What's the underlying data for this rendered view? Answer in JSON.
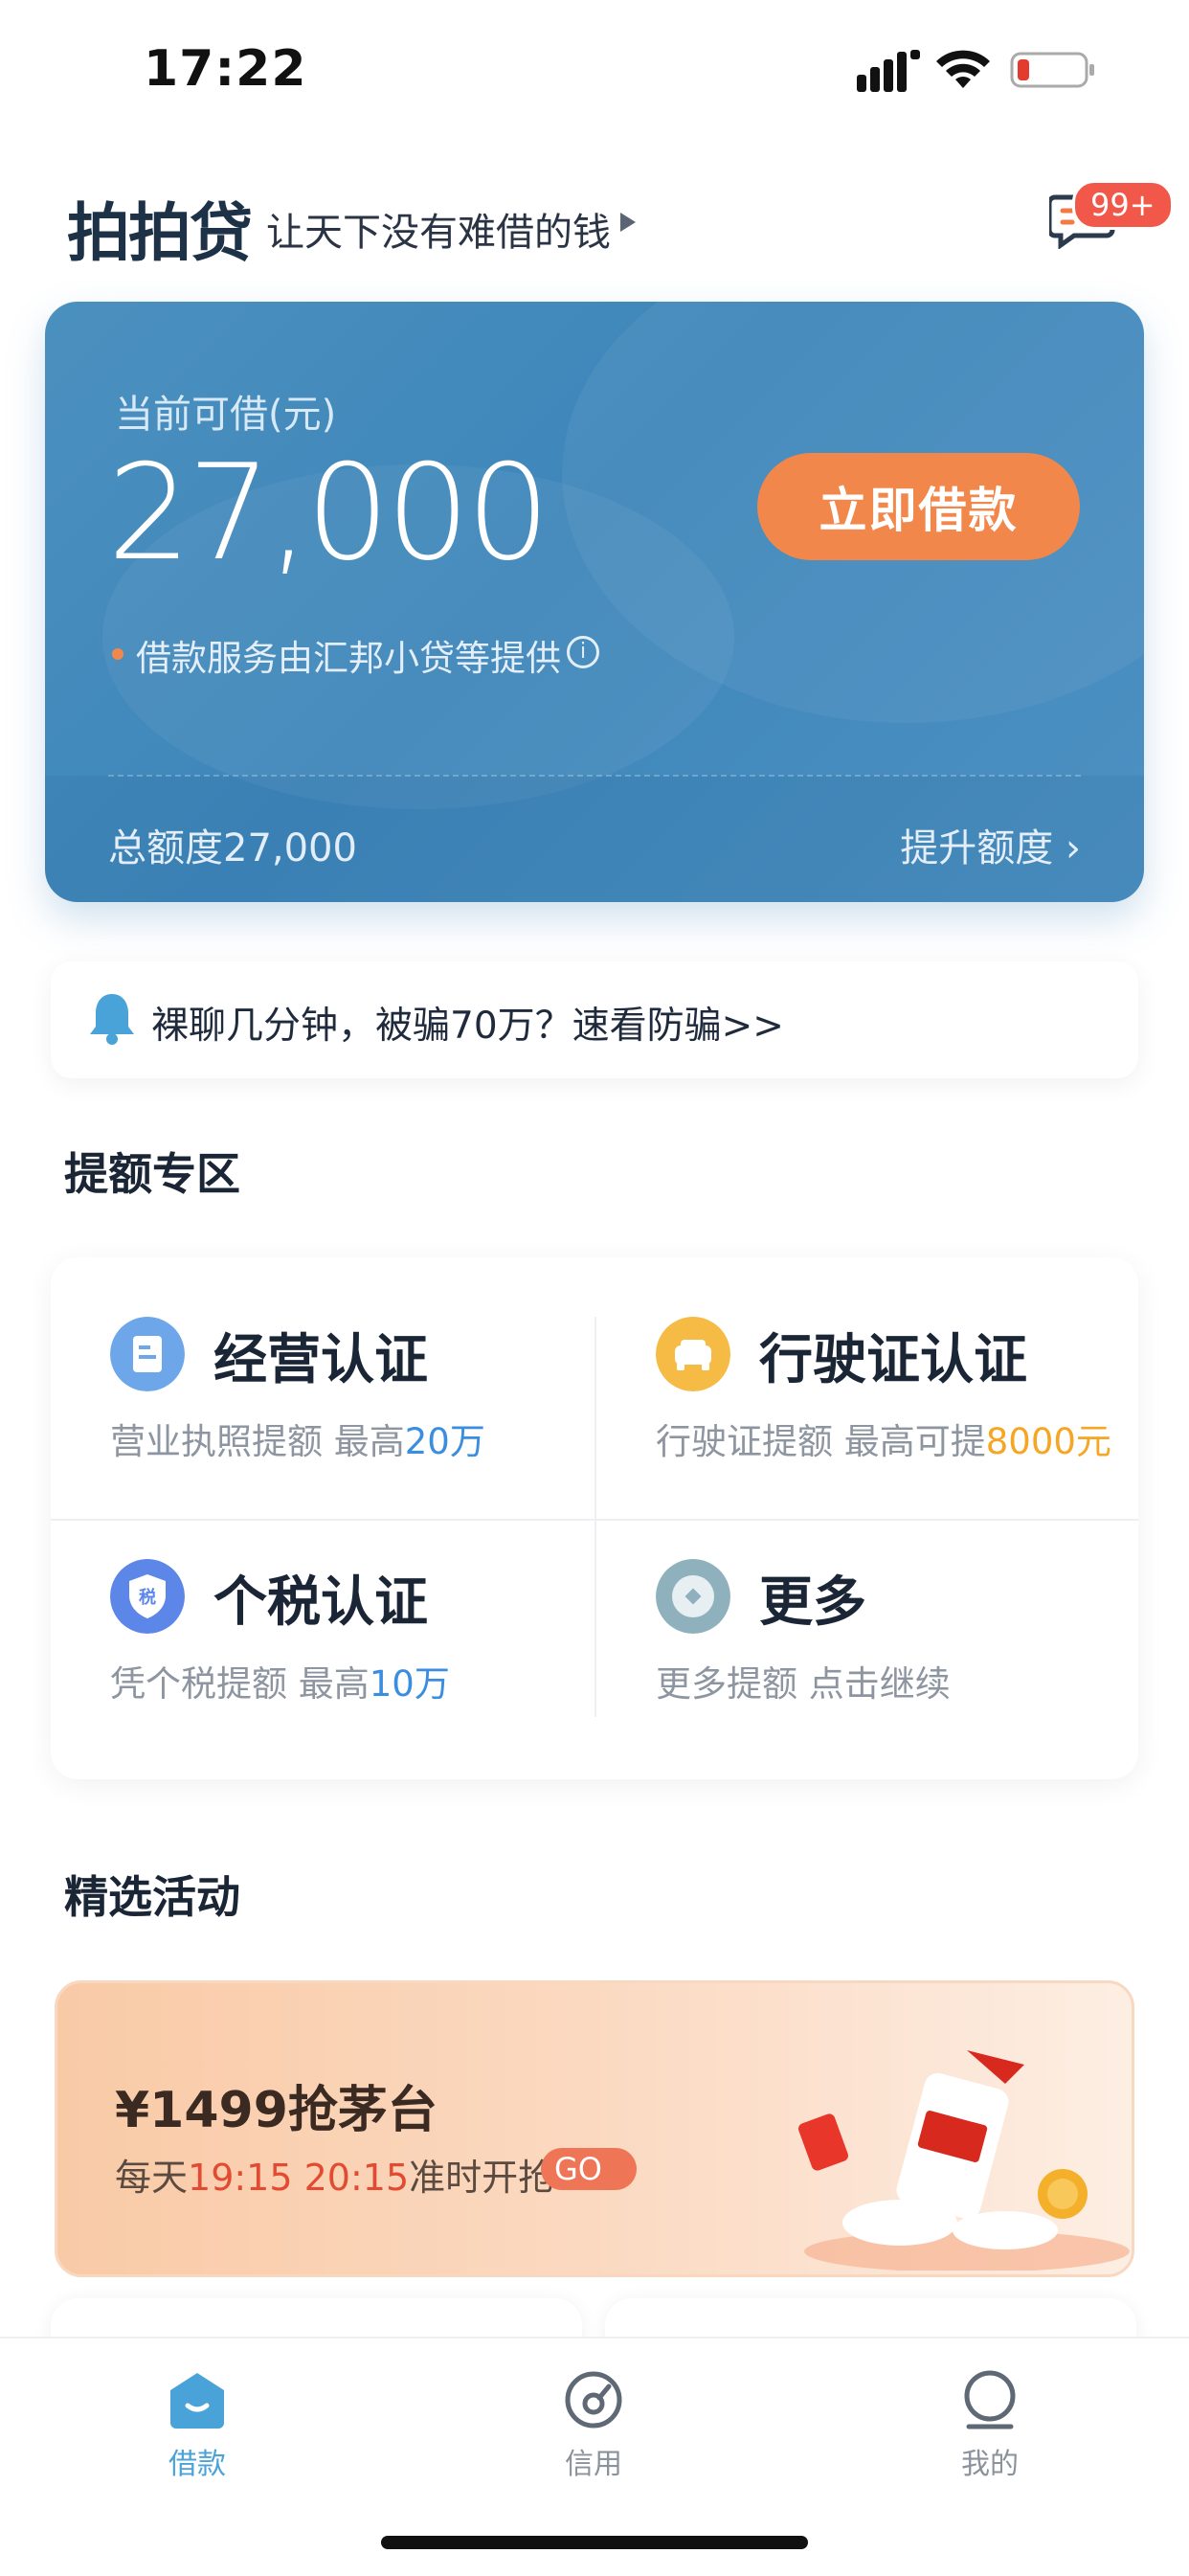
{
  "status_bar": {
    "time": "17:22"
  },
  "header": {
    "logo": "拍拍贷",
    "slogan": "让天下没有难借的钱",
    "message_badge": "99+"
  },
  "loan_card": {
    "label": "当前可借(元)",
    "amount": "27,000",
    "borrow_button": "立即借款",
    "provider": "借款服务由汇邦小贷等提供",
    "total_quota": "总额度27,000",
    "raise_quota": "提升额度 ›"
  },
  "notice": {
    "text": "裸聊几分钟，被骗70万？速看防骗>>"
  },
  "quota_section": {
    "title": "提额专区",
    "items": [
      {
        "title": "经营认证",
        "desc_prefix": "营业执照提额  最高",
        "highlight": "20万",
        "icon": "document-icon"
      },
      {
        "title": "行驶证认证",
        "desc_prefix": "行驶证提额  最高可提",
        "highlight": "8000元",
        "icon": "car-icon"
      },
      {
        "title": "个税认证",
        "desc_prefix": "凭个税提额  最高",
        "highlight": "10万",
        "icon": "tax-shield-icon"
      },
      {
        "title": "更多",
        "desc_prefix": "更多提额 点击继续",
        "highlight": "",
        "icon": "more-coin-icon"
      }
    ]
  },
  "activity_section": {
    "title": "精选活动",
    "banner": {
      "title": "¥1499抢茅台",
      "sub_prefix": "每天",
      "sub_times": "19:15  20:15",
      "sub_suffix": "准时开抢",
      "go_label": "GO"
    }
  },
  "tab_bar": {
    "tabs": [
      {
        "label": "借款",
        "active": true,
        "icon": "home-icon"
      },
      {
        "label": "信用",
        "active": false,
        "icon": "credit-gauge-icon"
      },
      {
        "label": "我的",
        "active": false,
        "icon": "profile-icon"
      }
    ]
  },
  "colors": {
    "card_blue": "#4289bc",
    "accent_orange": "#f2874b",
    "link_blue": "#3a8ddf",
    "badge_red": "#f2584a",
    "tab_active": "#4aa3d8",
    "tab_inactive": "#8a929c"
  }
}
